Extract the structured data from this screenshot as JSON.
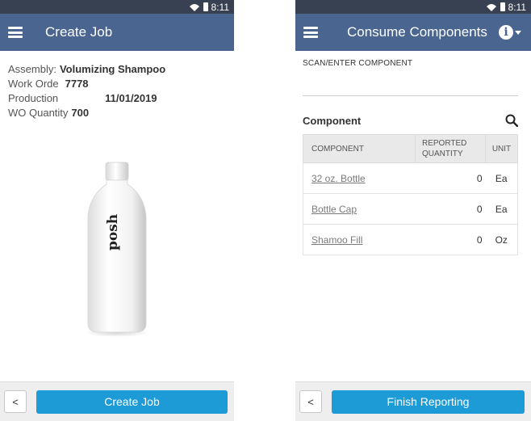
{
  "status_bar": {
    "time": "8:11"
  },
  "create_job": {
    "title": "Create Job",
    "fields": [
      {
        "label": "Assembly:",
        "value": "Volumizing Shampoo"
      },
      {
        "label": "Work Orde",
        "value": "7778"
      },
      {
        "label": "Production",
        "value": "11/01/2019"
      },
      {
        "label": "WO Quantity",
        "value": "700"
      }
    ],
    "product_brand": "posh",
    "back_label": "<",
    "primary_button": "Create Job"
  },
  "consume": {
    "title": "Consume Components",
    "info_icon": "info-icon",
    "scan_label": "SCAN/ENTER COMPONENT",
    "section_title": "Component",
    "columns": [
      "COMPONENT",
      "REPORTED QUANTITY",
      "UNIT"
    ],
    "rows": [
      {
        "component": "32 oz. Bottle",
        "quantity": "0",
        "unit": "Ea"
      },
      {
        "component": "Bottle Cap",
        "quantity": "0",
        "unit": "Ea"
      },
      {
        "component": "Shamoo Fill",
        "quantity": "0",
        "unit": "Oz"
      }
    ],
    "back_label": "<",
    "primary_button": "Finish Reporting"
  },
  "colors": {
    "appbar": "#4a6690",
    "statusbar": "#374151",
    "primary_button": "#1d9bd7"
  }
}
